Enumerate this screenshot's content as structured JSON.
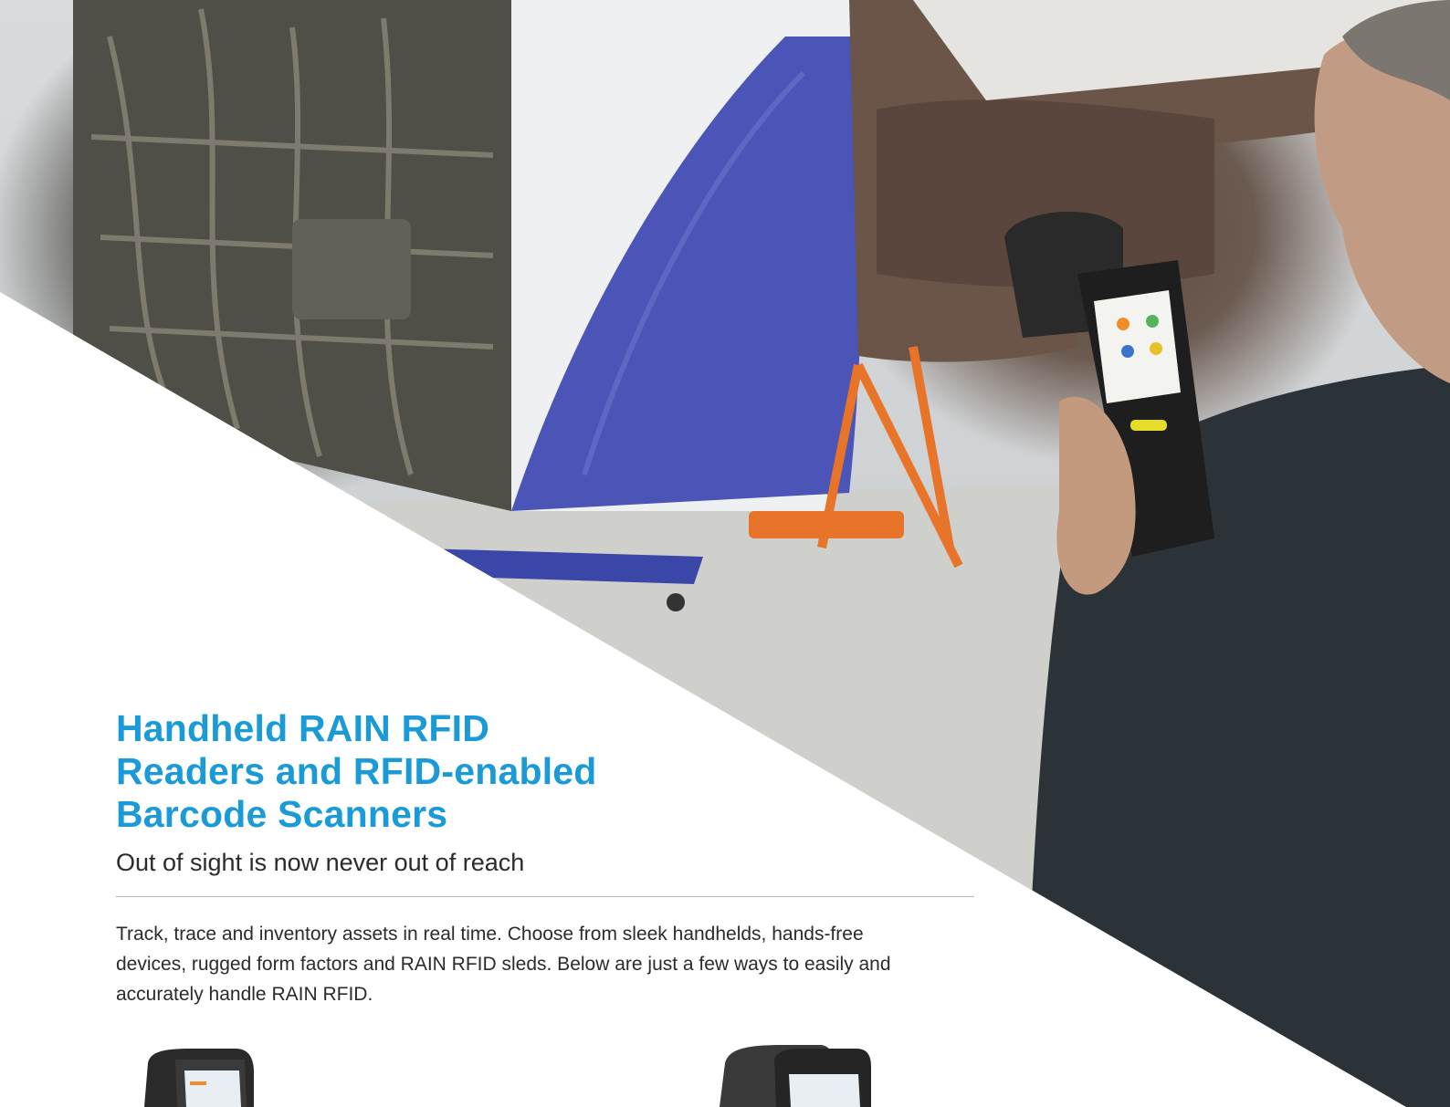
{
  "headline": {
    "line1": "Handheld RAIN RFID",
    "line2": "Readers and RFID-enabled",
    "line3": "Barcode Scanners"
  },
  "subhead": "Out of sight is now never out of reach",
  "body": "Track, trace and inventory assets in real time. Choose from sleek handhelds, hands-free devices, rugged form factors and RAIN RFID sleds. Below are just a few ways to easily and accurately handle RAIN RFID.",
  "colors": {
    "headline": "#1a9bd7",
    "text": "#2b2b2b",
    "rule": "#b5b5b5",
    "engine_blue": "#4b55b8"
  },
  "icons": {
    "hero_photo": "aircraft-engine-technician-photo-icon",
    "device_left": "rfid-handheld-device-icon",
    "device_right": "rfid-sled-device-icon"
  }
}
